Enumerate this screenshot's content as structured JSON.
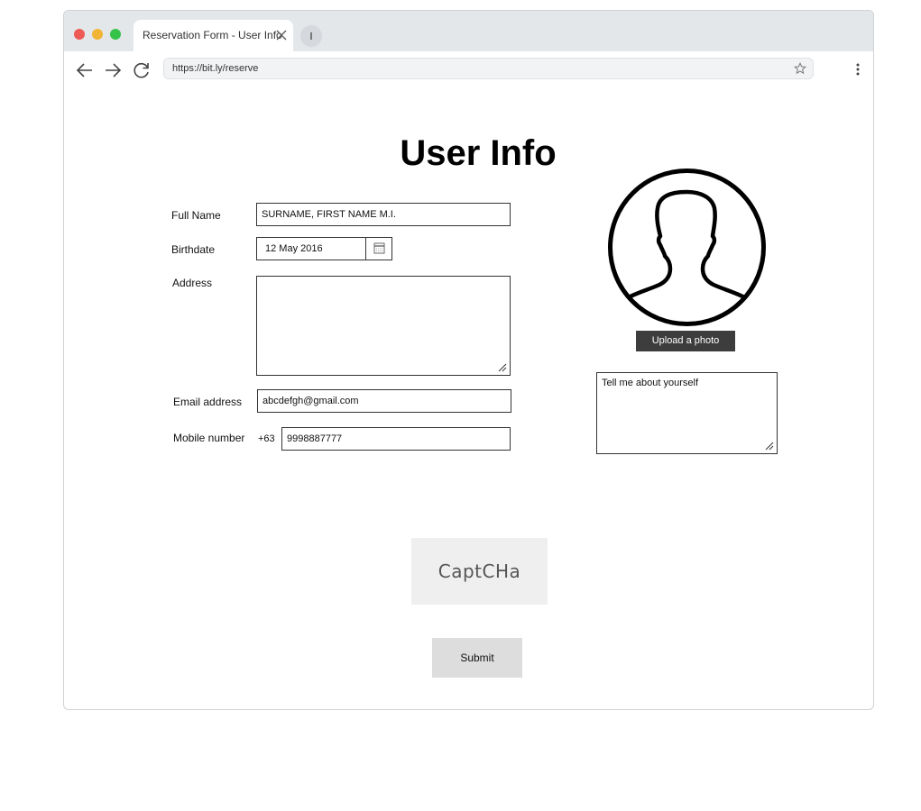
{
  "browser": {
    "tab_title": "Reservation Form - User Info",
    "url": "https://bit.ly/reserve"
  },
  "page": {
    "title": "User Info"
  },
  "form": {
    "full_name": {
      "label": "Full Name",
      "value": "SURNAME, FIRST NAME M.I."
    },
    "birthdate": {
      "label": "Birthdate",
      "value": "12 May 2016"
    },
    "address": {
      "label": "Address",
      "value": ""
    },
    "email": {
      "label": "Email address",
      "value": "abcdefgh@gmail.com"
    },
    "mobile": {
      "label": "Mobile number",
      "prefix": "+63",
      "value": "9998887777"
    }
  },
  "profile": {
    "upload_label": "Upload a photo",
    "about_placeholder": "Tell me about yourself"
  },
  "captcha": {
    "text": "CaptCHa"
  },
  "submit_label": "Submit",
  "icons": [
    "close-icon",
    "new-tab-icon",
    "back-icon",
    "forward-icon",
    "reload-icon",
    "star-icon",
    "menu-icon",
    "calendar-icon",
    "avatar-icon",
    "resize-handle-icon"
  ]
}
